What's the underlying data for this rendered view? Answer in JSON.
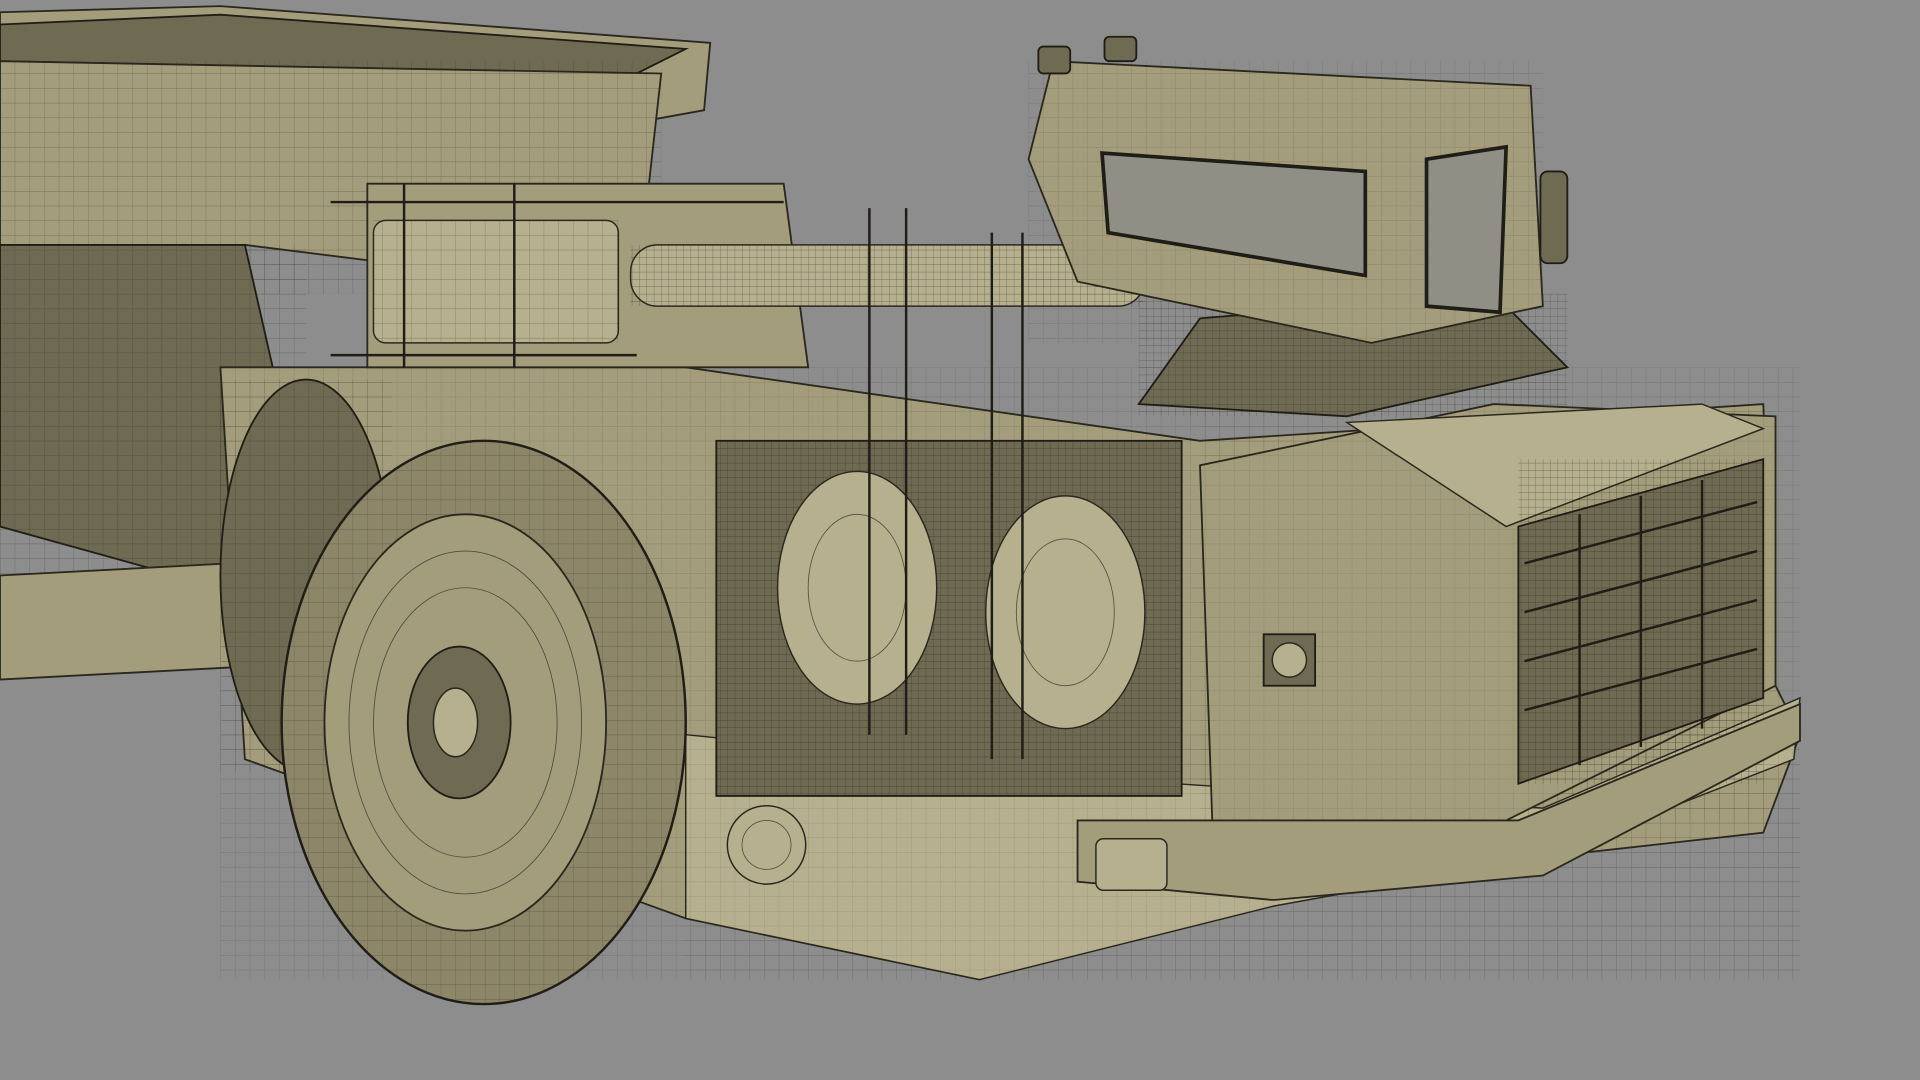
{
  "colors": {
    "background": "#8d8d8d",
    "body": "#a49d7c",
    "shadow": "#6f6a52",
    "wire": "#2a281e"
  }
}
